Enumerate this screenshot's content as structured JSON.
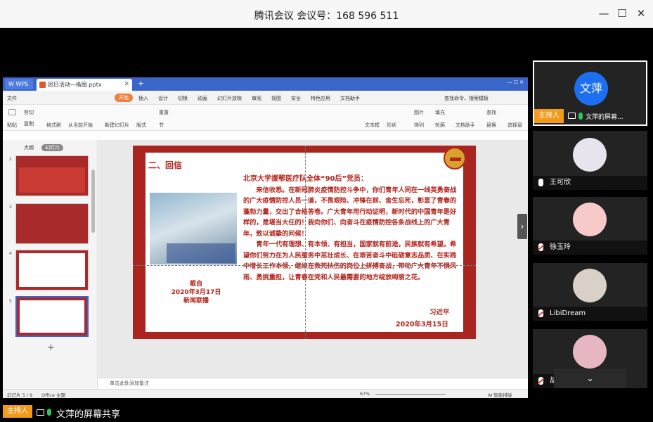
{
  "window": {
    "title": "腾讯会议 会议号：168 596 511"
  },
  "wps": {
    "logo": "W WPS",
    "doc_tab": "团日活动—楷图.pptx",
    "menu": [
      "文件",
      "开始",
      "插入",
      "设计",
      "切换",
      "动画",
      "幻灯片放映",
      "审阅",
      "视图",
      "安全",
      "特色应用",
      "文档助手"
    ],
    "search": "查找命令、搜索模板",
    "ribbon": {
      "paste": "粘贴",
      "cut": "剪切",
      "copy": "复制",
      "format_painter": "格式刷",
      "from_start": "从当前开始",
      "new_slide": "新建幻灯片",
      "layout": "版式",
      "section": "节",
      "reset": "重置",
      "textbox": "文本框",
      "shape": "形状",
      "image": "图片",
      "arrange": "排列",
      "fill": "填充",
      "outline": "轮廓",
      "find": "查找",
      "replace": "替换",
      "select": "选择窗",
      "doc_assistant": "文档助手"
    },
    "thumb_tabs": [
      "大纲",
      "幻灯片"
    ],
    "thumbs": [
      "2",
      "3",
      "4",
      "5"
    ],
    "notes_placeholder": "单击此处添加备注",
    "status": {
      "slide": "幻灯片 5 / 9",
      "theme": "Office 主题",
      "zoom": "67%",
      "ai": "AI·智能排版"
    },
    "slide": {
      "heading": "二、回信",
      "salutation": "北京大学援鄂医疗队全体“90后”党员：",
      "para1": "来信收悉。在新冠肺炎疫情防控斗争中，你们青年人同在一线英勇奋战的广大疫情防控人员一道，不畏艰险、冲锋在前、舍生忘死，彰显了青春的蓬勃力量，交出了合格答卷。广大青年用行动证明，新时代的中国青年是好样的，是堪当大任的！我向你们、向奋斗在疫情防控各条战线上的广大青年，致以诚挚的问候！",
      "para2": "青年一代有理想、有本领、有担当，国家就有前途，民族就有希望。希望你们努力在为人民服务中茁壮成长、在艰苦奋斗中砥砺意志品质、在实践中增长工作本领，继续在救死扶伤的岗位上拼搏奋战，带动广大青年不惧风雨、勇挑重担，让青春在党和人民最需要的地方绽放绚丽之花。",
      "signature": "习近平",
      "sign_date": "2020年3月15日",
      "caption_1": "截自",
      "caption_2": "2020年3月17日",
      "caption_3": "新闻联播"
    }
  },
  "participants": [
    {
      "name": "文萍的屏幕...",
      "avatar_text": "文萍",
      "host": "主持人",
      "mic": "on",
      "color": "#1d6ff2"
    },
    {
      "name": "王可欣",
      "mic": "on",
      "color": "#e8e4ee"
    },
    {
      "name": "徐玉玲",
      "mic": "off",
      "color": "#f7c9c9"
    },
    {
      "name": "LibiDream",
      "mic": "off",
      "color": "#d9d0c8"
    },
    {
      "name": "胡晓",
      "mic": "off",
      "color": "#e6b7c0"
    }
  ],
  "bottom": {
    "host_tag": "主持人",
    "share_label": "文萍的屏幕共享"
  },
  "colors": {
    "accent": "#f29a1c",
    "slide_red": "#a8261f",
    "wps_blue": "#3a66c9"
  }
}
